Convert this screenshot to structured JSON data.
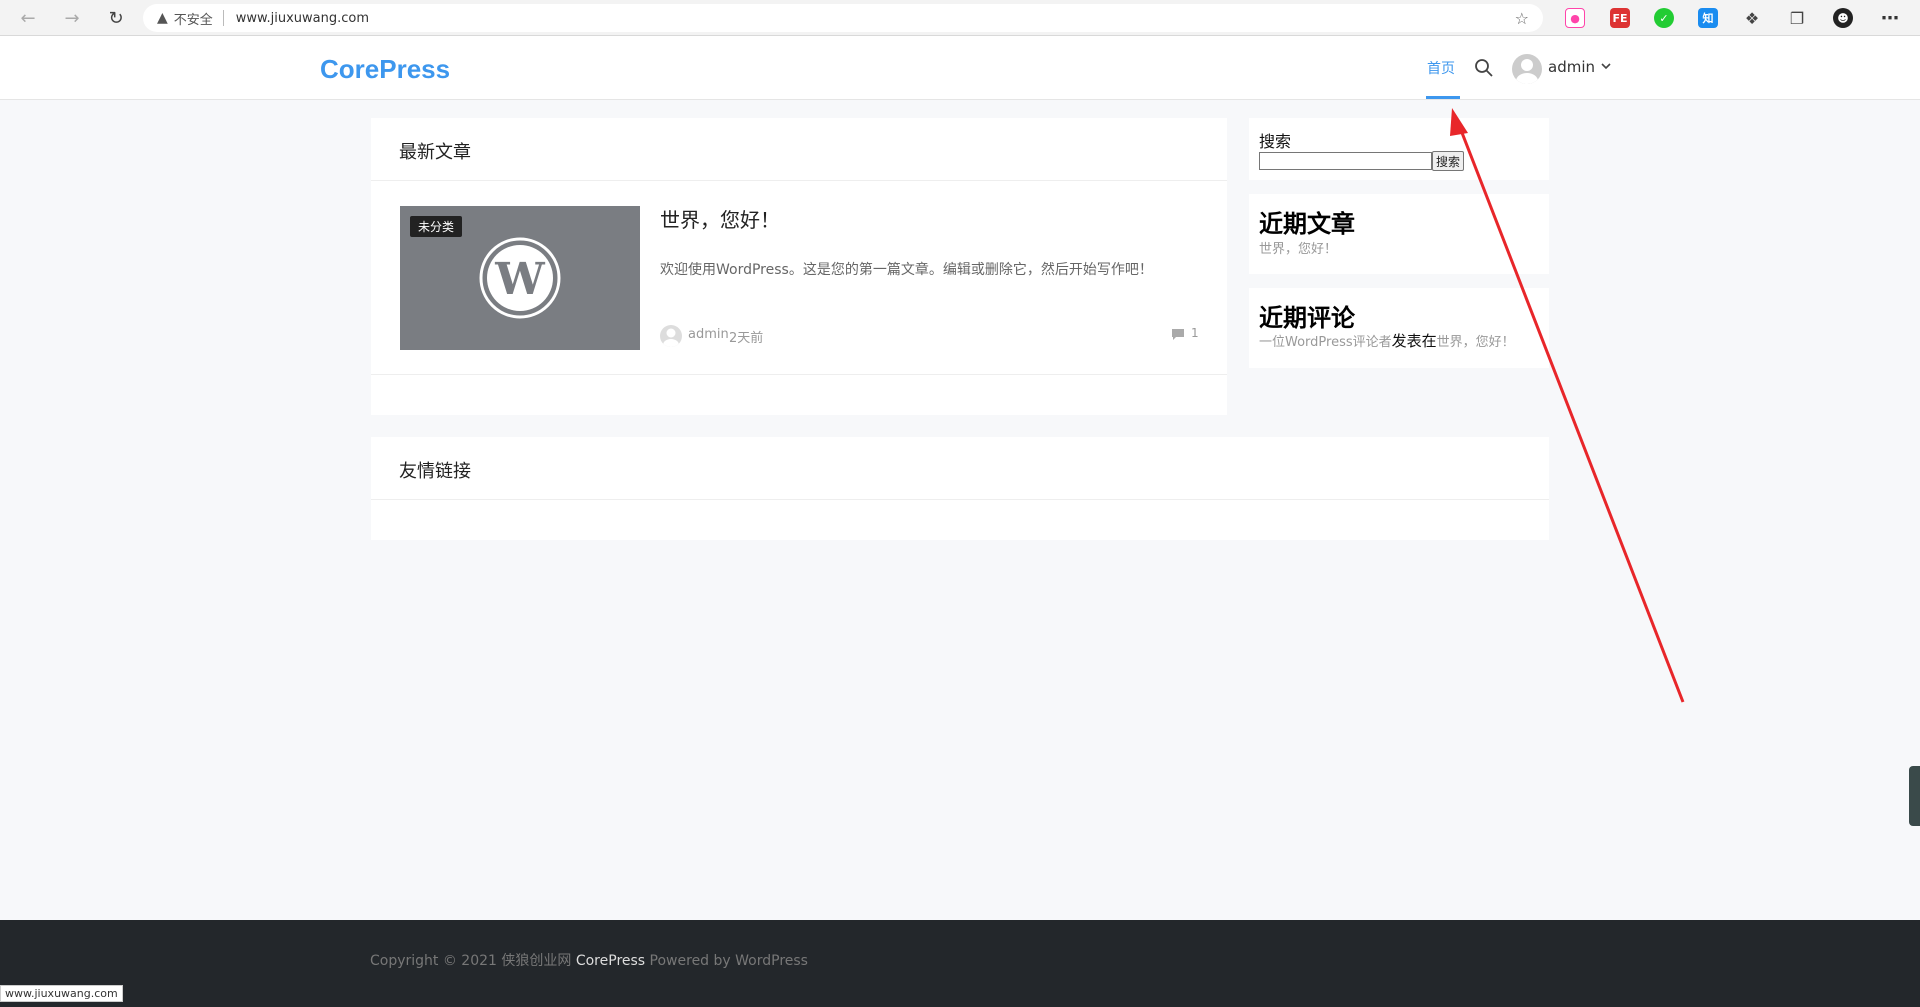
{
  "browser": {
    "insecure_label": "不安全",
    "url": "www.jiuxuwang.com"
  },
  "site": {
    "logo": "CorePress",
    "nav_home": "首页",
    "user_name": "admin"
  },
  "latest": {
    "title": "最新文章",
    "post": {
      "category": "未分类",
      "title": "世界，您好！",
      "excerpt": "欢迎使用WordPress。这是您的第一篇文章。编辑或删除它，然后开始写作吧！",
      "author": "admin",
      "time": "2天前",
      "comments": "1"
    }
  },
  "friends": {
    "title": "友情链接"
  },
  "sidebar": {
    "search_label": "搜索",
    "search_button": "搜索",
    "recent_posts_title": "近期文章",
    "recent_post": "世界，您好！",
    "recent_comments_title": "近期评论",
    "comment_author": "一位WordPress评论者",
    "comment_connector": "发表在",
    "comment_post": "世界，您好！"
  },
  "footer": {
    "copyright": "Copyright © 2021 侠狼创业网",
    "brand": "CorePress",
    "powered": "Powered by WordPress"
  },
  "status_bar": {
    "url": "www.jiuxuwang.com"
  }
}
